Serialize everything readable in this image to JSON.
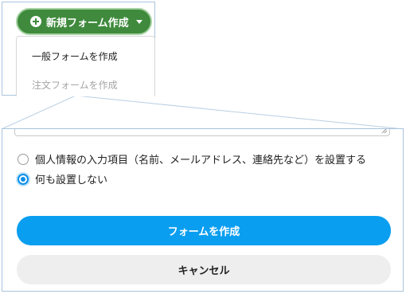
{
  "new_form_button": {
    "label": "新規フォーム作成"
  },
  "dropdown": {
    "items": [
      {
        "label": "一般フォームを作成",
        "enabled": true
      },
      {
        "label": "注文フォームを作成",
        "enabled": false
      }
    ]
  },
  "privacy_options": [
    {
      "label": "個人情報の入力項目（名前、メールアドレス、連絡先など）を設置する",
      "selected": false
    },
    {
      "label": "何も設置しない",
      "selected": true
    }
  ],
  "buttons": {
    "create_label": "フォームを作成",
    "cancel_label": "キャンセル"
  },
  "colors": {
    "new_form_button_bg": "#3f8a3d",
    "primary_button": "#0a9ef0",
    "secondary_button": "#eeeeee",
    "radio_selected": "#0a8fe8",
    "disabled_text": "#a5a5a5",
    "zoom_frame": "#a9c4de"
  },
  "icons": {
    "new_form_icon": "plus-circle-icon",
    "new_form_caret": "caret-down-icon"
  }
}
